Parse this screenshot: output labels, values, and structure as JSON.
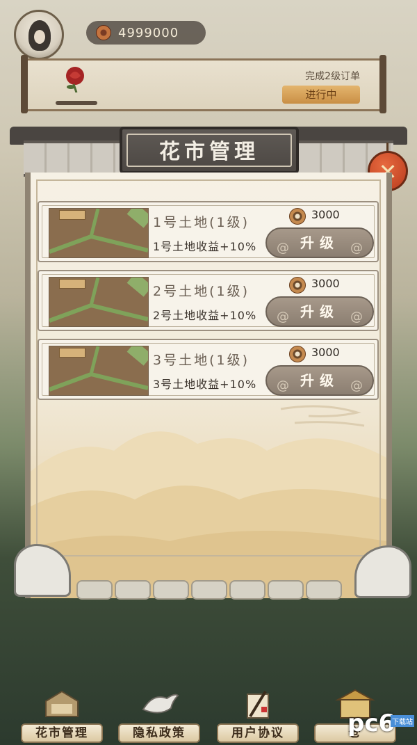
{
  "hud": {
    "coins": "4999000"
  },
  "order": {
    "description": "完成2级订单",
    "status": "进行中"
  },
  "dialog": {
    "title": "花市管理",
    "close_label": "✕",
    "lands": [
      {
        "title": "1号土地(1级)",
        "bonus": "1号土地收益+10%",
        "cost": "3000",
        "button": "升级"
      },
      {
        "title": "2号土地(1级)",
        "bonus": "2号土地收益+10%",
        "cost": "3000",
        "button": "升级"
      },
      {
        "title": "3号土地(1级)",
        "bonus": "3号土地收益+10%",
        "cost": "3000",
        "button": "升级"
      }
    ]
  },
  "nav": [
    {
      "label": "花市管理",
      "icon": "flower-market-icon"
    },
    {
      "label": "隐私政策",
      "icon": "dove-icon"
    },
    {
      "label": "用户协议",
      "icon": "scroll-brush-icon"
    },
    {
      "label": "仓",
      "icon": "warehouse-icon"
    }
  ],
  "watermark": {
    "big": "pc6",
    "small": "下载站"
  },
  "colors": {
    "accent": "#c9893f",
    "close": "#c3461f",
    "button": "#9c8f81"
  }
}
